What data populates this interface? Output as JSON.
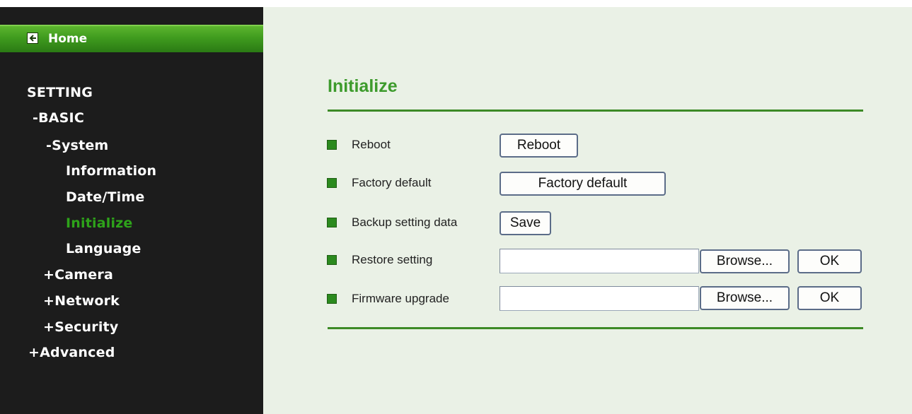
{
  "sidebar": {
    "home_label": "Home",
    "items": [
      {
        "label": "SETTING",
        "active": false
      },
      {
        "label": "-BASIC",
        "active": false
      },
      {
        "label": "-System",
        "active": false
      },
      {
        "label": "Information",
        "active": false
      },
      {
        "label": "Date/Time",
        "active": false
      },
      {
        "label": "Initialize",
        "active": true
      },
      {
        "label": "Language",
        "active": false
      },
      {
        "label": "+Camera",
        "active": false
      },
      {
        "label": "+Network",
        "active": false
      },
      {
        "label": "+Security",
        "active": false
      },
      {
        "label": "+Advanced",
        "active": false
      }
    ]
  },
  "page": {
    "title": "Initialize",
    "rows": [
      {
        "label": "Reboot",
        "button": "Reboot"
      },
      {
        "label": "Factory default",
        "button": "Factory default"
      },
      {
        "label": "Backup setting data",
        "button": "Save"
      },
      {
        "label": "Restore setting",
        "input_value": "",
        "browse": "Browse...",
        "ok": "OK"
      },
      {
        "label": "Firmware upgrade",
        "input_value": "",
        "browse": "Browse...",
        "ok": "OK"
      }
    ]
  },
  "colors": {
    "sidebar_bg": "#1c1c1c",
    "home_bar": "#3f9b1e",
    "active_item": "#2ea31a",
    "main_bg": "#eaf1e6",
    "title": "#3d9b2c",
    "divider": "#3d8a26",
    "row_marker": "#2b8a1e"
  },
  "icons": {
    "home": "back-arrow-icon"
  }
}
